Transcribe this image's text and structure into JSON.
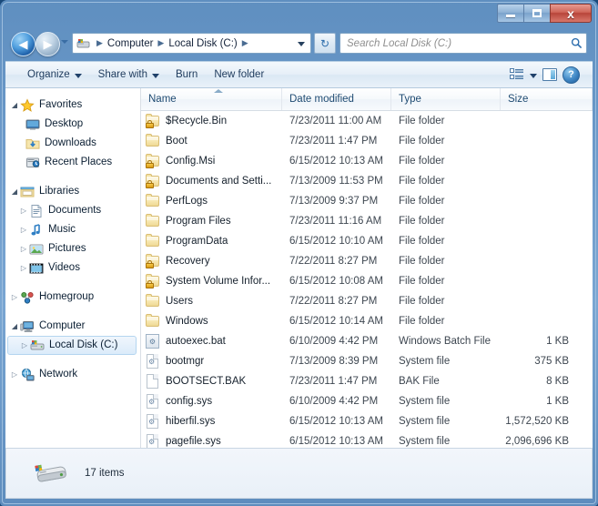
{
  "window": {
    "caption_buttons": {
      "minimize": "minimize-button",
      "maximize": "maximize-button",
      "close_label": "x"
    }
  },
  "address_bar": {
    "back_glyph": "◀",
    "forward_glyph": "▶",
    "crumbs": [
      "Computer",
      "Local Disk (C:)"
    ],
    "separator": "▶",
    "refresh_glyph": "↻"
  },
  "search": {
    "placeholder": "Search Local Disk (C:)",
    "icon_glyph": "⌕"
  },
  "toolbar": {
    "organize_label": "Organize",
    "share_label": "Share with",
    "burn_label": "Burn",
    "new_folder_label": "New folder",
    "help_glyph": "?"
  },
  "sidebar": {
    "groups": [
      {
        "header": {
          "label": "Favorites",
          "icon": "star-icon",
          "expander": "◢"
        },
        "items": [
          {
            "label": "Desktop",
            "icon": "desktop-icon"
          },
          {
            "label": "Downloads",
            "icon": "downloads-icon"
          },
          {
            "label": "Recent Places",
            "icon": "recent-places-icon"
          }
        ]
      },
      {
        "header": {
          "label": "Libraries",
          "icon": "libraries-icon",
          "expander": "◢"
        },
        "items": [
          {
            "label": "Documents",
            "icon": "documents-icon",
            "expander": "▷"
          },
          {
            "label": "Music",
            "icon": "music-icon",
            "expander": "▷"
          },
          {
            "label": "Pictures",
            "icon": "pictures-icon",
            "expander": "▷"
          },
          {
            "label": "Videos",
            "icon": "videos-icon",
            "expander": "▷"
          }
        ]
      },
      {
        "header": {
          "label": "Homegroup",
          "icon": "homegroup-icon",
          "expander": "▷"
        },
        "items": []
      },
      {
        "header": {
          "label": "Computer",
          "icon": "computer-icon",
          "expander": "◢"
        },
        "items": [
          {
            "label": "Local Disk (C:)",
            "icon": "drive-icon",
            "expander": "▷",
            "selected": true
          }
        ]
      },
      {
        "header": {
          "label": "Network",
          "icon": "network-icon",
          "expander": "▷"
        },
        "items": []
      }
    ]
  },
  "filelist": {
    "columns": [
      {
        "label": "Name",
        "sorted": "asc"
      },
      {
        "label": "Date modified"
      },
      {
        "label": "Type"
      },
      {
        "label": "Size"
      }
    ],
    "rows": [
      {
        "name": "$Recycle.Bin",
        "date": "7/23/2011 11:00 AM",
        "type": "File folder",
        "size": "",
        "icon": "folder-locked-icon"
      },
      {
        "name": "Boot",
        "date": "7/23/2011 1:47 PM",
        "type": "File folder",
        "size": "",
        "icon": "folder-icon"
      },
      {
        "name": "Config.Msi",
        "date": "6/15/2012 10:13 AM",
        "type": "File folder",
        "size": "",
        "icon": "folder-locked-icon"
      },
      {
        "name": "Documents and Setti...",
        "date": "7/13/2009 11:53 PM",
        "type": "File folder",
        "size": "",
        "icon": "folder-locked-icon"
      },
      {
        "name": "PerfLogs",
        "date": "7/13/2009 9:37 PM",
        "type": "File folder",
        "size": "",
        "icon": "folder-icon"
      },
      {
        "name": "Program Files",
        "date": "7/23/2011 11:16 AM",
        "type": "File folder",
        "size": "",
        "icon": "folder-icon"
      },
      {
        "name": "ProgramData",
        "date": "6/15/2012 10:10 AM",
        "type": "File folder",
        "size": "",
        "icon": "folder-icon"
      },
      {
        "name": "Recovery",
        "date": "7/22/2011 8:27 PM",
        "type": "File folder",
        "size": "",
        "icon": "folder-locked-icon"
      },
      {
        "name": "System Volume Infor...",
        "date": "6/15/2012 10:08 AM",
        "type": "File folder",
        "size": "",
        "icon": "folder-locked-icon"
      },
      {
        "name": "Users",
        "date": "7/22/2011 8:27 PM",
        "type": "File folder",
        "size": "",
        "icon": "folder-icon"
      },
      {
        "name": "Windows",
        "date": "6/15/2012 10:14 AM",
        "type": "File folder",
        "size": "",
        "icon": "folder-icon"
      },
      {
        "name": "autoexec.bat",
        "date": "6/10/2009 4:42 PM",
        "type": "Windows Batch File",
        "size": "1 KB",
        "icon": "batch-file-icon"
      },
      {
        "name": "bootmgr",
        "date": "7/13/2009 8:39 PM",
        "type": "System file",
        "size": "375 KB",
        "icon": "system-file-icon"
      },
      {
        "name": "BOOTSECT.BAK",
        "date": "7/23/2011 1:47 PM",
        "type": "BAK File",
        "size": "8 KB",
        "icon": "generic-file-icon"
      },
      {
        "name": "config.sys",
        "date": "6/10/2009 4:42 PM",
        "type": "System file",
        "size": "1 KB",
        "icon": "system-file-icon"
      },
      {
        "name": "hiberfil.sys",
        "date": "6/15/2012 10:13 AM",
        "type": "System file",
        "size": "1,572,520 KB",
        "icon": "system-file-icon"
      },
      {
        "name": "pagefile.sys",
        "date": "6/15/2012 10:13 AM",
        "type": "System file",
        "size": "2,096,696 KB",
        "icon": "system-file-icon"
      }
    ]
  },
  "statusbar": {
    "item_count": "17 items",
    "icon": "local-disk-icon"
  },
  "colors": {
    "frame": "#6f9ccb",
    "close_button": "#c2564a",
    "folder": "#f6e6ae",
    "selection": "#dbebfa",
    "header_text": "#1f4b72"
  }
}
